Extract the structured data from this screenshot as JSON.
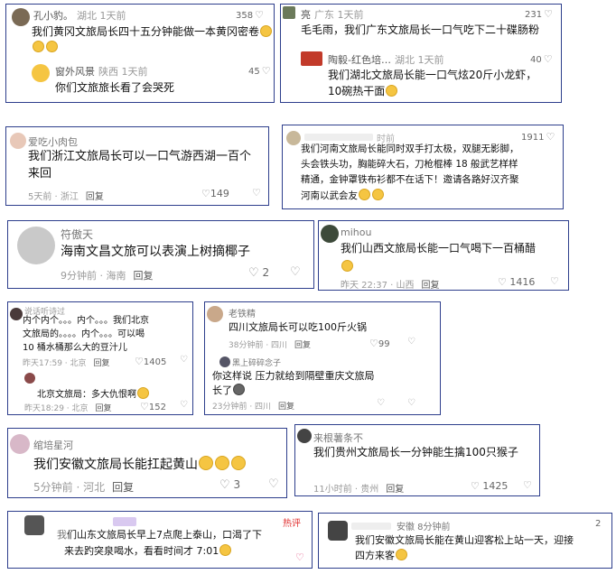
{
  "c1": {
    "user": "孔小豹。",
    "loc": "湖北 1天前",
    "likes": "358",
    "text": "我们黄冈文旅局长四十五分钟能做一本黄冈密卷",
    "reply_user": "窗外风景",
    "reply_loc": "陕西 1天前",
    "reply_likes": "45",
    "reply_text": "你们文旅旅长看了会哭死"
  },
  "c2": {
    "user": "亮",
    "loc": "广东 1天前",
    "likes": "231",
    "text": "毛毛雨，我们广东文旅局长一口气吃下二十碟肠粉",
    "reply_user": "陶毅-红色培…",
    "reply_loc": "湖北 1天前",
    "reply_likes": "40",
    "reply_text1": "我们湖北文旅局长能一口气炫20斤小龙虾，",
    "reply_text2": "10碗热干面"
  },
  "c3": {
    "user": "爱吃小肉包",
    "text1": "我们浙江文旅局长可以一口气游西湖一百个",
    "text2": "来回",
    "time": "5天前 · 浙江",
    "reply": "回复",
    "likes": "149"
  },
  "c4": {
    "time_top": "时前",
    "likes_top": "1911",
    "lines": [
      "我们河南文旅局长能同时双手打太极，双腿无影脚，",
      "头会铁头功，胸能碎大石，刀枪棍棒 18 般武艺样样",
      "精通，金钟罩铁布衫都不在话下！邀请各路好汉齐聚",
      "河南以武会友"
    ]
  },
  "c5": {
    "user": "符傲天",
    "text": "海南文昌文旅可以表演上树摘椰子",
    "time": "9分钟前 · 海南",
    "reply": "回复",
    "likes": "2"
  },
  "c6": {
    "user": "mihou",
    "text": "我们山西文旅局长能一口气喝下一百桶醋",
    "time": "昨天 22:37 · 山西",
    "reply": "回复",
    "likes": "1416"
  },
  "c7": {
    "user": "说话听诗过",
    "lines": [
      "内个内个。。。内个。。。我们北京",
      "文旅局的。。。。内个。。。可以喝",
      "10 桶水桶那么大的豆汁儿"
    ],
    "time": "昨天17:59 · 北京",
    "reply": "回复",
    "likes": "1405",
    "reply_text": "北京文旅局：多大仇恨啊",
    "reply_time": "昨天18:29 · 北京",
    "reply_reply": "回复",
    "reply_likes": "152"
  },
  "c8": {
    "user": "老铁精",
    "text": "四川文旅局长可以吃100斤火锅",
    "time": "38分钟前 · 四川",
    "reply": "回复",
    "likes": "99",
    "reply_user": "黑上碎碎念子",
    "reply_text1": "你这样说 压力就给到隔壁重庆文旅局",
    "reply_text2": "长了",
    "reply_time": "23分钟前 · 四川",
    "reply_reply": "回复"
  },
  "c9": {
    "user": "绾培星河",
    "text": "我们安徽文旅局长能扛起黄山",
    "time": "5分钟前 · 河北",
    "reply": "回复",
    "likes": "3"
  },
  "c10": {
    "user": "来根薯条不",
    "text": "我们贵州文旅局长一分钟能生擒100只猴子",
    "time": "11小时前 · 贵州",
    "reply": "回复",
    "likes": "1425"
  },
  "c11": {
    "user": "我",
    "badge": "热评",
    "lines": [
      "们山东文旅局长早上7点爬上泰山，口渴了下",
      "来去趵突泉喝水，看看时间才 7:01"
    ]
  },
  "c12": {
    "user": "安徽 8分钟前",
    "likes": "2",
    "lines": [
      "我们安徽文旅局长能在黄山迎客松上站一天，迎接",
      "四方来客"
    ]
  }
}
